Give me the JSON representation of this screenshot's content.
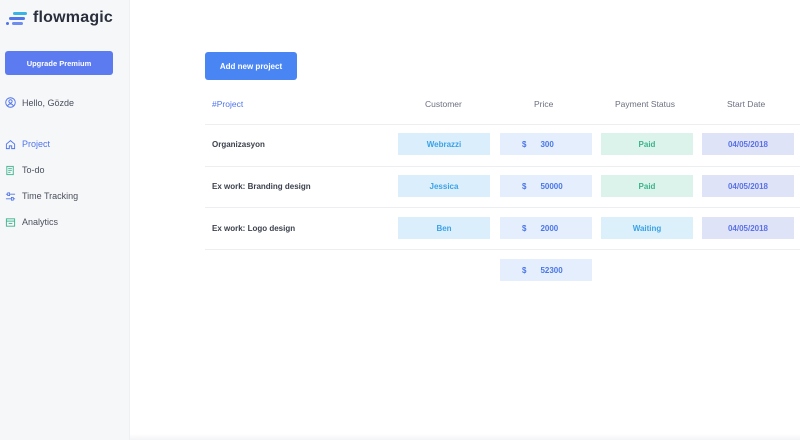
{
  "app": {
    "name": "flowmagic"
  },
  "sidebar": {
    "upgrade_label": "Upgrade Premium",
    "greeting": "Hello, Gözde",
    "items": [
      {
        "label": "Project",
        "icon": "home-icon",
        "active": true
      },
      {
        "label": "To-do",
        "icon": "todo-icon",
        "active": false
      },
      {
        "label": "Time Tracking",
        "icon": "sliders-icon",
        "active": false
      },
      {
        "label": "Analytics",
        "icon": "analytics-icon",
        "active": false
      }
    ]
  },
  "main": {
    "add_button_label": "Add new project",
    "columns": [
      "#Project",
      "Customer",
      "Price",
      "Payment Status",
      "Start Date"
    ],
    "currency": "$",
    "rows": [
      {
        "project": "Organizasyon",
        "customer": "Webrazzi",
        "price": "300",
        "status": "Paid",
        "start_date": "04/05/2018"
      },
      {
        "project": "Ex work: Branding design",
        "customer": "Jessica",
        "price": "50000",
        "status": "Paid",
        "start_date": "04/05/2018"
      },
      {
        "project": "Ex work: Logo design",
        "customer": "Ben",
        "price": "2000",
        "status": "Waiting",
        "start_date": "04/05/2018"
      }
    ],
    "total": "52300"
  },
  "colors": {
    "accent": "#4a86f3",
    "upgrade": "#5c7bf0",
    "paid": "#3db38c",
    "waiting": "#3aa2e6"
  }
}
